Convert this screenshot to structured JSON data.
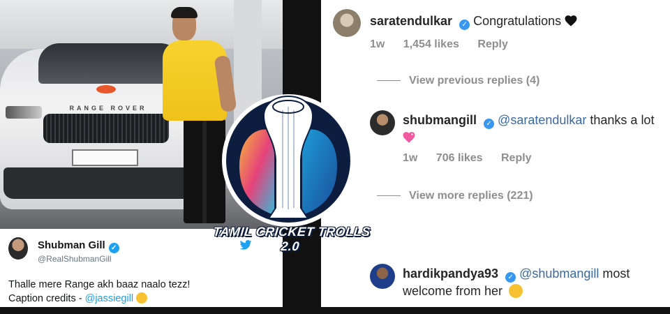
{
  "left": {
    "photo": {
      "car_brand_text": "RANGE ROVER"
    },
    "tweet": {
      "display_name": "Shubman Gill",
      "handle": "@RealShubmanGill",
      "text_line1": "Thalle mere Range akh baaz naalo tezz!",
      "text_line2_prefix": "Caption credits - ",
      "text_line2_mention": "@jassiegill",
      "verified_icon": "verified-badge-icon",
      "bird_icon": "twitter-bird-icon"
    }
  },
  "watermark": {
    "text": "TAMIL CRICKET TROLLS 2.0"
  },
  "right": {
    "comments": [
      {
        "user": "saratendulkar",
        "text": "Congratulations",
        "emoji": "black-heart",
        "time": "1w",
        "likes": "1,454 likes",
        "reply": "Reply"
      },
      {
        "user": "shubmangill",
        "mention": "@saratendulkar",
        "text": " thanks a lot",
        "emoji": "sparkling-heart",
        "time": "1w",
        "likes": "706 likes",
        "reply": "Reply"
      },
      {
        "user": "hardikpandya93",
        "mention": "@shubmangill",
        "text": " most welcome from her",
        "emoji": "winking-face-with-tongue"
      }
    ],
    "view_previous": "View previous replies (4)",
    "view_more": "View more replies (221)"
  },
  "colors": {
    "twitter_blue": "#1da1f2",
    "instagram_verified": "#3897f0",
    "mention_blue": "#3b6aa0",
    "meta_gray": "#8e8e8e",
    "shirt_yellow": "#f7d22e"
  }
}
